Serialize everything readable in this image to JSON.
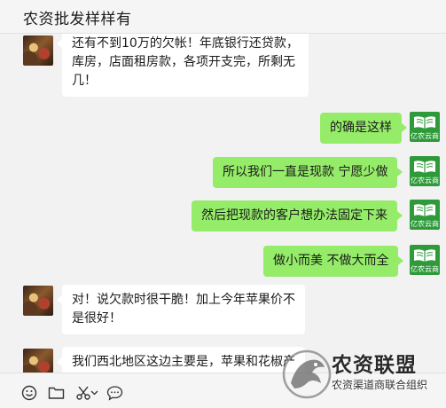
{
  "header": {
    "title": "农资批发样样有"
  },
  "messages": [
    {
      "side": "in",
      "lines": [
        "还有不到10万的欠帐！年底银行还贷款，",
        "库房，店面租房款，各项开支完，所剩无",
        "几！"
      ]
    },
    {
      "side": "out",
      "lines": [
        "的确是这样"
      ]
    },
    {
      "side": "out",
      "lines": [
        "所以我们一直是现款 宁愿少做"
      ]
    },
    {
      "side": "out",
      "lines": [
        "然后把现款的客户想办法固定下来"
      ]
    },
    {
      "side": "out",
      "lines": [
        "做小而美 不做大而全"
      ]
    },
    {
      "side": "in",
      "lines": [
        "对！说欠款时很干脆！加上今年苹果价不",
        "是很好！"
      ]
    },
    {
      "side": "in",
      "lines": [
        "我们西北地区这边主要是，苹果和花椒产"
      ]
    }
  ],
  "self_avatar": {
    "brand": "亿农云商",
    "color": "#2f9a3a"
  },
  "toolbar": {
    "icons": [
      "emoji-icon",
      "folder-icon",
      "scissors-icon",
      "chevron-down-icon",
      "chat-bubble-icon"
    ]
  },
  "watermark": {
    "title": "农资联盟",
    "subtitle": "农资渠道商联合组织"
  },
  "colors": {
    "incoming_bubble": "#ffffff",
    "outgoing_bubble": "#95ec69",
    "background": "#f2f2f2"
  }
}
